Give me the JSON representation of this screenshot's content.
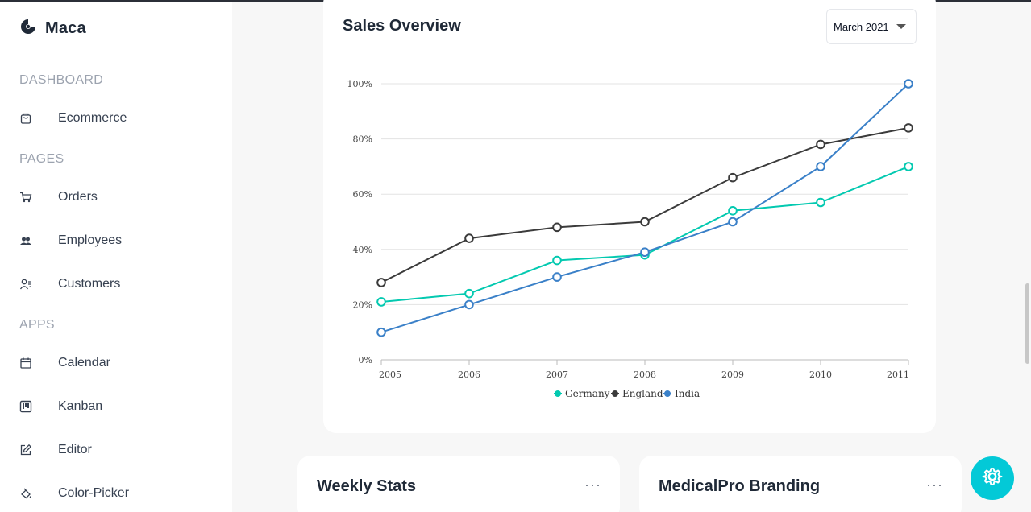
{
  "brand": {
    "name": "Maca",
    "icon": "maca-logo-icon"
  },
  "sidebar": {
    "sections": [
      {
        "title": "DASHBOARD",
        "items": [
          {
            "label": "Ecommerce",
            "icon": "shopping-bag-icon"
          }
        ]
      },
      {
        "title": "PAGES",
        "items": [
          {
            "label": "Orders",
            "icon": "cart-icon"
          },
          {
            "label": "Employees",
            "icon": "employees-icon"
          },
          {
            "label": "Customers",
            "icon": "customers-icon"
          }
        ]
      },
      {
        "title": "APPS",
        "items": [
          {
            "label": "Calendar",
            "icon": "calendar-icon"
          },
          {
            "label": "Kanban",
            "icon": "kanban-icon"
          },
          {
            "label": "Editor",
            "icon": "editor-icon"
          },
          {
            "label": "Color-Picker",
            "icon": "color-picker-icon"
          }
        ]
      }
    ]
  },
  "sales": {
    "title": "Sales Overview",
    "month_selected": "March 2021"
  },
  "chart_data": {
    "type": "line",
    "x": [
      "2005",
      "2006",
      "2007",
      "2008",
      "2009",
      "2010",
      "2011"
    ],
    "y_ticks": [
      "0%",
      "20%",
      "40%",
      "60%",
      "80%",
      "100%"
    ],
    "ylim": [
      0,
      100
    ],
    "grid": "horizontal",
    "legend_position": "bottom-center",
    "series": [
      {
        "name": "Germany",
        "color": "#03c9b0",
        "values": [
          21,
          24,
          36,
          38,
          54,
          57,
          70
        ]
      },
      {
        "name": "England",
        "color": "#3b3b3b",
        "values": [
          28,
          44,
          48,
          50,
          66,
          78,
          84
        ]
      },
      {
        "name": "India",
        "color": "#3a80c8",
        "values": [
          10,
          20,
          30,
          39,
          50,
          70,
          100
        ]
      }
    ]
  },
  "cards": {
    "weekly": {
      "title": "Weekly Stats",
      "more": "···"
    },
    "branding": {
      "title": "MedicalPro Branding",
      "more": "···"
    }
  },
  "settings": {
    "icon": "gear-icon",
    "color": "#03c9d7"
  }
}
